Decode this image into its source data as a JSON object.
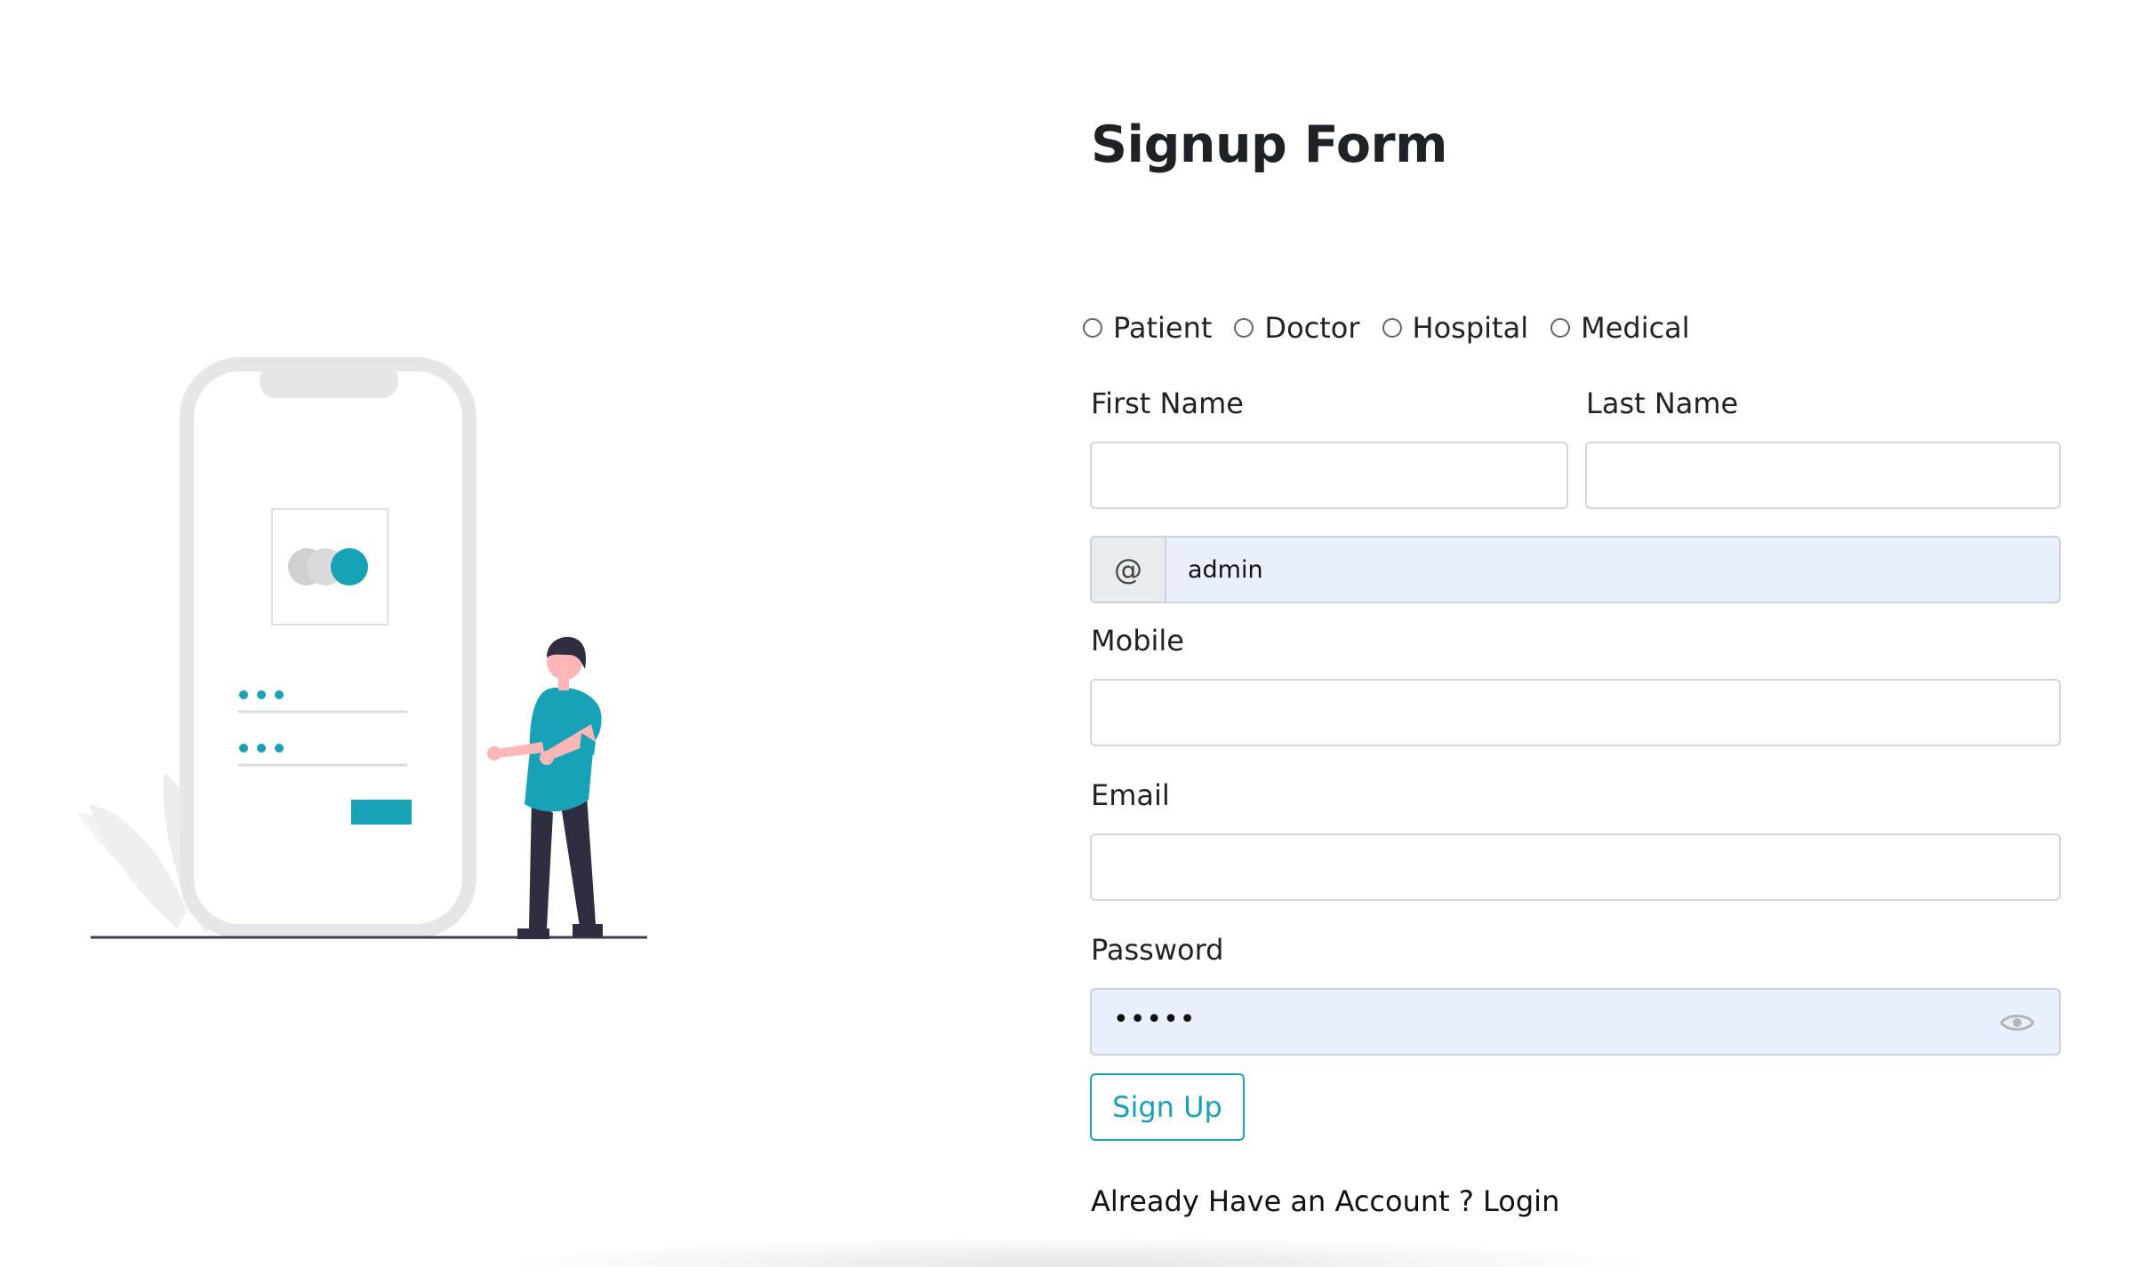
{
  "form": {
    "title": "Signup Form",
    "roles": [
      "Patient",
      "Doctor",
      "Hospital",
      "Medical"
    ],
    "first_name_label": "First Name",
    "last_name_label": "Last Name",
    "username_addon": "@",
    "username_value": "admin",
    "mobile_label": "Mobile",
    "email_label": "Email",
    "password_label": "Password",
    "password_value": "•••••",
    "submit_label": "Sign Up",
    "login_prompt": "Already Have an Account ? Login"
  },
  "colors": {
    "accent": "#17a2b8",
    "autofill_bg": "#e8f0fe",
    "illustration_gray": "#e6e6e6",
    "person_pants": "#2f2e41",
    "skin": "#ffb6b6"
  },
  "icons": {
    "password_toggle": "eye-icon"
  }
}
